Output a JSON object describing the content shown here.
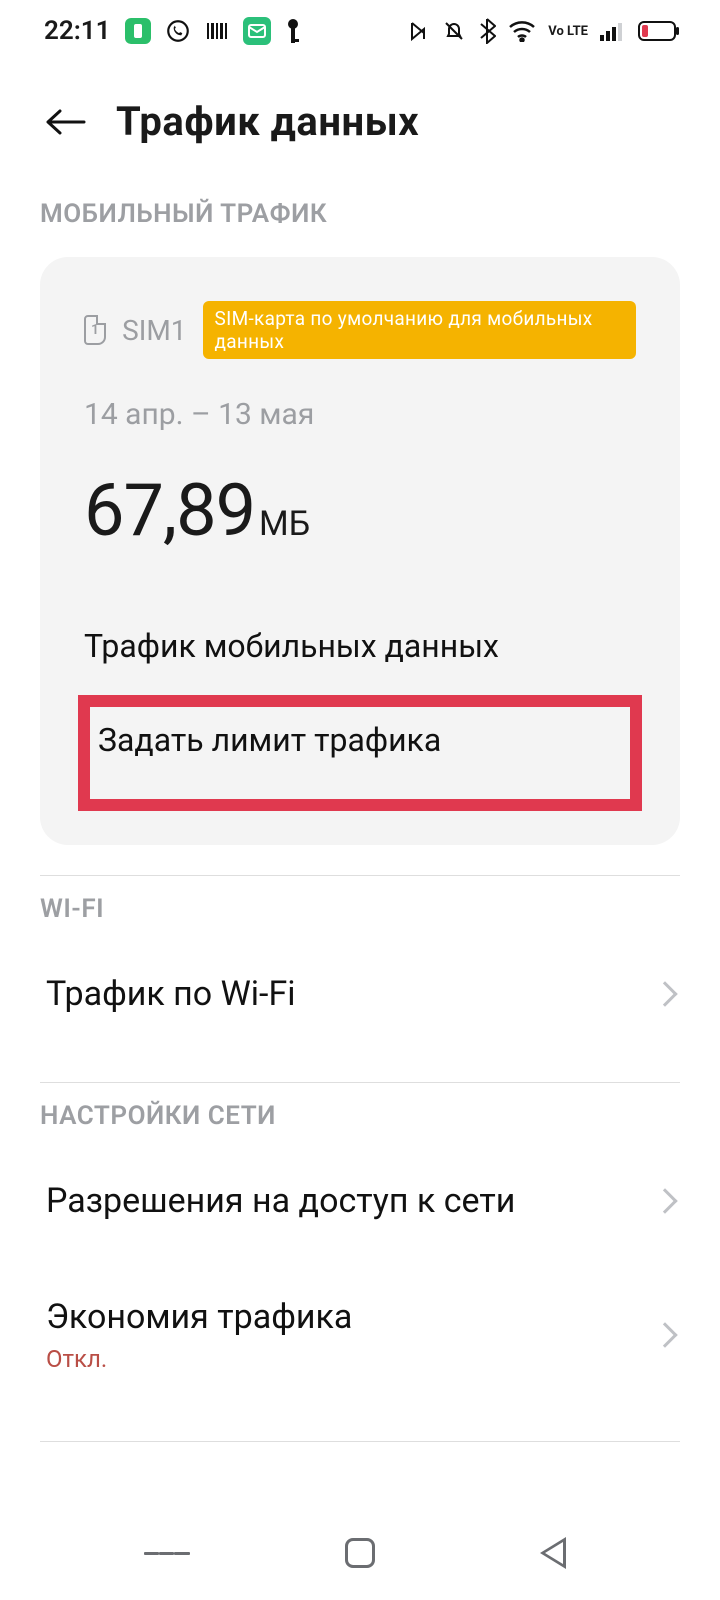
{
  "statusbar": {
    "time": "22:11",
    "volte": "Vo LTE"
  },
  "header": {
    "title": "Трафик данных"
  },
  "sections": {
    "mobile": "МОБИЛЬНЫЙ ТРАФИК",
    "wifi": "WI-FI",
    "network": "НАСТРОЙКИ СЕТИ"
  },
  "card": {
    "sim_label": "SIM1",
    "badge": "SIM-карта по умолчанию для мобильных данных",
    "date_range": "14 апр. – 13 мая",
    "usage_value": "67,89",
    "usage_unit": "МБ",
    "mobile_traffic": "Трафик мобильных данных",
    "set_limit": "Задать лимит трафика"
  },
  "rows": {
    "wifi_traffic": "Трафик по Wi-Fi",
    "net_permissions": "Разрешения на доступ к сети",
    "data_saver": "Экономия трафика",
    "data_saver_state": "Откл."
  }
}
